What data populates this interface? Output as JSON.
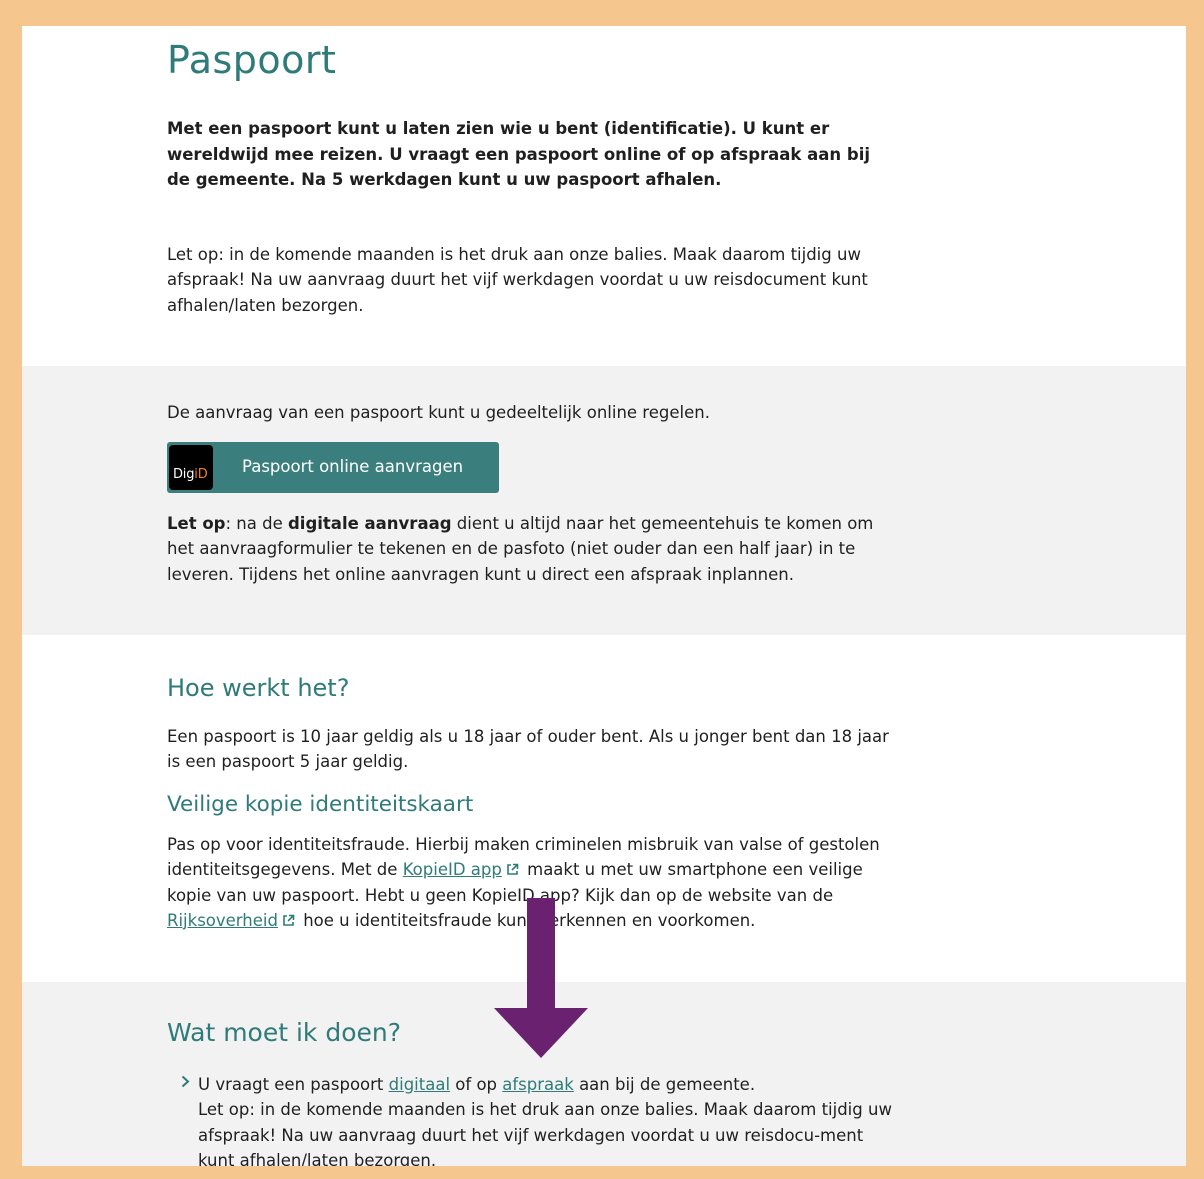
{
  "page": {
    "title": "Paspoort",
    "intro": "Met een paspoort kunt u laten zien wie u bent (identificatie). U kunt er wereldwijd mee reizen. U vraagt een paspoort online of op afspraak aan bij de gemeente. Na 5 werkdagen kunt u uw paspoort afhalen.",
    "notice": "Let op: in de komende maanden is het druk aan onze balies. Maak daarom tijdig uw afspraak! Na uw aanvraag duurt het vijf werkdagen voordat u uw reisdocument kunt afhalen/laten bezorgen."
  },
  "online": {
    "text": "De aanvraag van een paspoort kunt u gedeeltelijk online regelen.",
    "button_label": "Paspoort online aanvragen",
    "logo_text_a": "Dig",
    "logo_text_b": "iD",
    "note_lead": "Let op",
    "note_part1": ": na de ",
    "note_bold": "digitale aanvraag",
    "note_part2": " dient u altijd naar het gemeentehuis te komen om het aanvraagformulier te tekenen en de pasfoto (niet ouder dan een half jaar) in te leveren. Tijdens het online aanvragen kunt u direct een afspraak inplannen."
  },
  "how": {
    "heading": "Hoe werkt het?",
    "text": "Een paspoort is 10 jaar geldig als u 18 jaar of ouder bent. Als u jonger bent dan 18 jaar is een paspoort 5 jaar geldig.",
    "sub_heading": "Veilige kopie identiteitskaart",
    "fraud_part1": "Pas op voor identiteitsfraude. Hierbij maken criminelen misbruik van valse of gestolen identiteitsgegevens. Met de ",
    "link_kopieid": "KopieID app",
    "fraud_part2": " maakt u met uw smartphone een veilige kopie van uw paspoort. Hebt u geen KopieID app? Kijk dan op de website van de ",
    "link_rijksoverheid": "Rijksoverheid",
    "fraud_part3": " hoe u identiteitsfraude kunt herkennen en voorkomen."
  },
  "todo": {
    "heading": "Wat moet ik doen?",
    "item_part1": "U vraagt een paspoort ",
    "link_digitaal": "digitaal",
    "item_part2": " of op ",
    "link_afspraak": "afspraak",
    "item_part3": " aan bij de gemeente.",
    "item_note": "Let op: in de komende maanden is het druk aan onze balies. Maak daarom tijdig uw afspraak! Na uw aanvraag duurt het vijf werkdagen voordat u uw reisdocu-ment kunt afhalen/laten bezorgen."
  },
  "colors": {
    "accent": "#2f7b7a",
    "button": "#3a7f7d",
    "frame": "#f5c78f",
    "arrow": "#6a2170",
    "grey_band": "#f2f2f2"
  },
  "icons": [
    "external-link-icon",
    "chevron-right-icon",
    "down-arrow-annotation"
  ]
}
